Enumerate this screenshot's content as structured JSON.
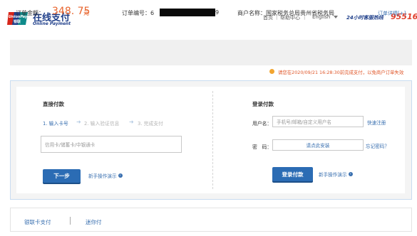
{
  "header": {
    "logo_badge_top": "UnionPay",
    "logo_badge_bottom": "银联",
    "logo_cn": "在线支付",
    "logo_en": "Online Payment",
    "nav": {
      "home": "首页",
      "sep1": "|",
      "help": "帮助中心",
      "sep2": "|",
      "language": "English"
    },
    "hotline_label": "24小时客服热线",
    "hotline_number": "95516"
  },
  "order": {
    "amount_label": "订单金额：",
    "amount": "348. 75",
    "currency": "元",
    "order_no_label": "订单编号：6",
    "order_no_tail": "9",
    "merchant_label": "商户名称：国家税务总局贵州省税务局",
    "detail_link": "订单详情[+]"
  },
  "notice": "请您在2020/09/21 16:28:30前完成支付，以免商户订单失效",
  "direct_pay": {
    "title": "直接付款",
    "steps": [
      "1. 输入卡号",
      "2. 输入验证信息",
      "3. 完成支付"
    ],
    "card_input_placeholder": "信用卡/储蓄卡/中银通卡",
    "next_button": "下一步",
    "help_link": "新手操作演示"
  },
  "login_pay": {
    "title": "登录付款",
    "username_label": "用户名：",
    "username_placeholder": "手机号/邮箱/自定义用户名",
    "register_link": "快速注册",
    "password_label": "密　码：",
    "password_placeholder": "请点此安装",
    "forgot_link": "忘记密码？",
    "login_button": "登录付款",
    "help_link": "新手操作演示"
  },
  "bottom_tabs": [
    "银联卡支付",
    "迷你付"
  ],
  "colors": {
    "brand_blue": "#2b6cb4",
    "accent_orange": "#e8642c",
    "hotline_red": "#e0402d"
  }
}
